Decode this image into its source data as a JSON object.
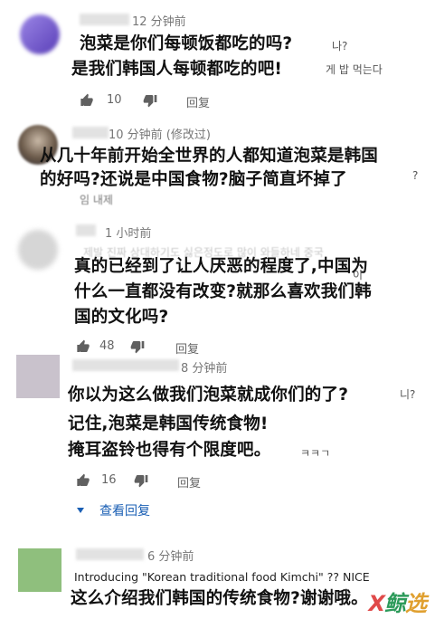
{
  "comments": [
    {
      "time": "12 分钟前",
      "lines": [
        "泡菜是你们每顿饭都吃的吗?",
        "是我们韩国人每顿都吃的吧!"
      ],
      "korean_fragments": [
        "나?",
        "게 밥 먹는다"
      ],
      "likes": "10",
      "reply_label": "回复"
    },
    {
      "time": "10 分钟前 (修改过)",
      "lines": [
        "从几十年前开始全世界的人都知道泡菜是韩国",
        "的好吗?还说是中国食物?脑子简直坏掉了"
      ],
      "korean_fragments": [
        "?",
        "임 내제"
      ]
    },
    {
      "time": "1 小时前",
      "lines": [
        "真的已经到了让人厌恶的程度了,中国为",
        "什么一直都没有改变?就那么喜欢我们韩",
        "国的文化吗?"
      ],
      "korean_fragments": [
        "제발 진짜 상대하기도 싫은정도로 많이 와들하네 중국",
        "이"
      ],
      "likes": "48",
      "reply_label": "回复"
    },
    {
      "time": "8 分钟前",
      "lines": [
        "你以为这么做我们泡菜就成你们的了?",
        "记住,泡菜是韩国传统食物!",
        "掩耳盗铃也得有个限度吧。"
      ],
      "korean_fragments": [
        "니?",
        "ㅋㅋㄱ"
      ],
      "likes": "16",
      "reply_label": "回复",
      "view_replies": "查看回复"
    },
    {
      "time": "6 分钟前",
      "english": "Introducing \"Korean traditional food Kimchi\" ?? NICE",
      "lines": [
        "这么介绍我们韩国的传统食物?谢谢哦。"
      ]
    }
  ],
  "colors": {
    "avatar1": "#7b5fd0",
    "avatar2": "#6b5a4a",
    "avatar3": "#d6d6d6",
    "avatar4": "#c9c2cc",
    "avatar5": "#8fbf7d",
    "link": "#1a5fb4"
  },
  "icons": {
    "like": "thumb-up-icon",
    "dislike": "thumb-down-icon",
    "expand": "caret-down-icon"
  }
}
